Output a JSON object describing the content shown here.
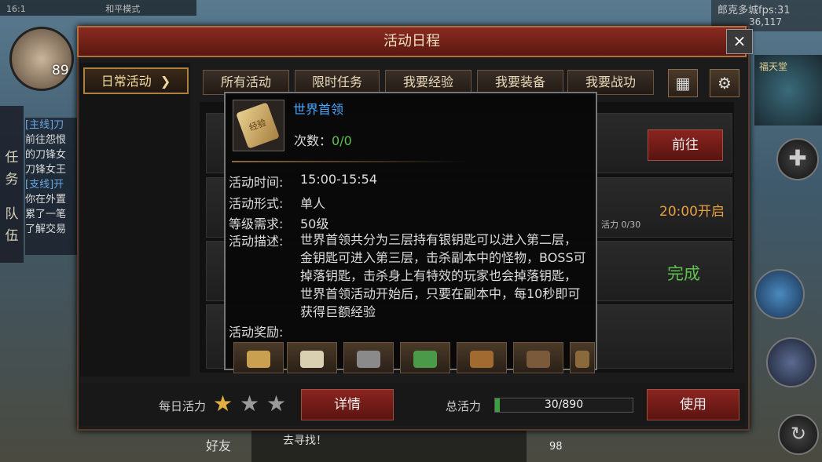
{
  "hud": {
    "time": "16:1",
    "mode": "和平模式",
    "level": "89",
    "side_tabs": [
      "任",
      "务",
      "队",
      "伍"
    ],
    "quest_lines": [
      "[主线]刀",
      "前往怨恨",
      "的刀锋女",
      "刀锋女王",
      "[支线]开",
      "你在外置",
      "累了一笔",
      "了解交易"
    ],
    "fps_line1": "郎克多城fps:31",
    "fps_line2": "36,117",
    "map_label": "福天堂",
    "chat_text": "去寻找！",
    "friend": "好友",
    "bottom_level": "98"
  },
  "dialog": {
    "title": "活动日程",
    "close": "×",
    "left_button": "日常活动",
    "left_arrow": "❯",
    "tabs": [
      "所有活动",
      "限时任务",
      "我要经验",
      "我要装备",
      "我要战功"
    ],
    "calendar_icon": "calendar-icon",
    "settings_icon": "gear-icon",
    "rows": {
      "goto": "前往",
      "open_time": "20:00开启",
      "vitality_small": "活力 0/30",
      "complete": "完成"
    },
    "footer": {
      "daily_vitality": "每日活力",
      "stars_filled": 1,
      "stars_total": 3,
      "detail": "详情",
      "total_vitality": "总活力",
      "vitality_value": "30/890",
      "vitality_fraction": 0.034,
      "use": "使用"
    }
  },
  "popup": {
    "item_text": "经验",
    "title": "世界首领",
    "count_label": "次数：",
    "count_value": "0/0",
    "time_label": "活动时间:",
    "time_value": "15:00-15:54",
    "form_label": "活动形式:",
    "form_value": "单人",
    "level_label": "等级需求:",
    "level_value": "50级",
    "desc_label": "活动描述:",
    "desc_value": "世界首领共分为三层持有银钥匙可以进入第二层，金钥匙可进入第三层，击杀副本中的怪物，BOSS可掉落钥匙，击杀身上有特效的玩家也会掉落钥匙，世界首领活动开始后，只要在副本中，每10秒即可获得巨额经验",
    "reward_label": "活动奖励:"
  },
  "colors": {
    "title_red": "#8a2a20",
    "link_blue": "#4aa8ff",
    "green": "#60c050",
    "orange": "#e8a040",
    "star_gold": "#e0b040"
  }
}
